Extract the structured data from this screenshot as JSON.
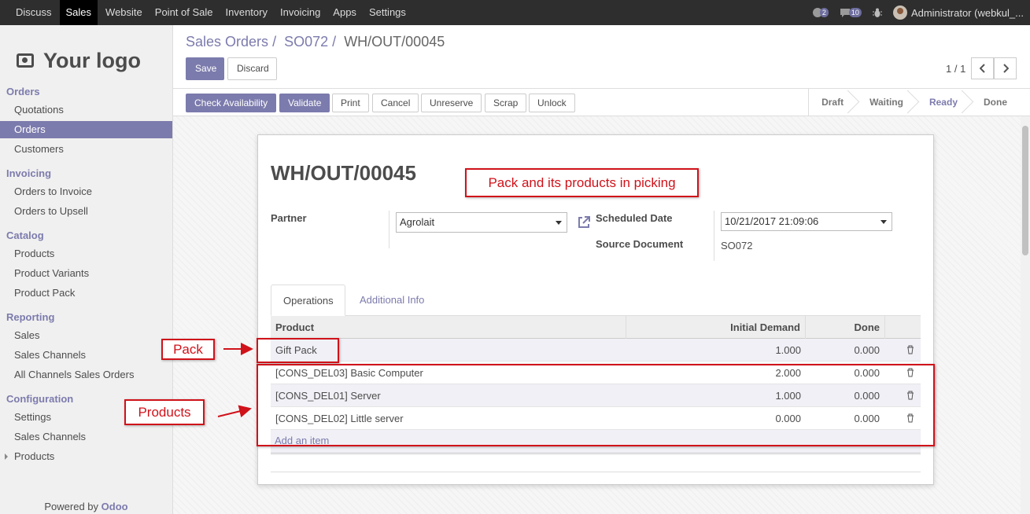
{
  "topbar": {
    "menu": [
      "Discuss",
      "Sales",
      "Website",
      "Point of Sale",
      "Inventory",
      "Invoicing",
      "Apps",
      "Settings"
    ],
    "active_menu": "Sales",
    "chat_count": "2",
    "message_count": "10",
    "user": "Administrator (webkul_..."
  },
  "sidebar": {
    "logo_text": "Your logo",
    "sections": [
      {
        "title": "Orders",
        "items": [
          "Quotations",
          "Orders",
          "Customers"
        ]
      },
      {
        "title": "Invoicing",
        "items": [
          "Orders to Invoice",
          "Orders to Upsell"
        ]
      },
      {
        "title": "Catalog",
        "items": [
          "Products",
          "Product Variants",
          "Product Pack"
        ]
      },
      {
        "title": "Reporting",
        "items": [
          "Sales",
          "Sales Channels",
          "All Channels Sales Orders"
        ]
      },
      {
        "title": "Configuration",
        "items": [
          "Settings",
          "Sales Channels",
          "Products"
        ]
      }
    ],
    "active_item": "Orders",
    "powered_by": "Powered by",
    "powered_brand": "Odoo"
  },
  "breadcrumb": {
    "items": [
      "Sales Orders",
      "SO072"
    ],
    "current": "WH/OUT/00045",
    "sep": "/"
  },
  "control": {
    "save": "Save",
    "discard": "Discard",
    "pager": "1 / 1"
  },
  "actions": [
    "Check Availability",
    "Validate",
    "Print",
    "Cancel",
    "Unreserve",
    "Scrap",
    "Unlock"
  ],
  "stages": [
    "Draft",
    "Waiting",
    "Ready",
    "Done"
  ],
  "current_stage": "Ready",
  "record": {
    "name": "WH/OUT/00045",
    "partner_label": "Partner",
    "partner_value": "Agrolait",
    "scheduled_label": "Scheduled Date",
    "scheduled_value": "10/21/2017 21:09:06",
    "source_label": "Source Document",
    "source_value": "SO072"
  },
  "tabs": [
    "Operations",
    "Additional Info"
  ],
  "table": {
    "headers": [
      "Product",
      "Initial Demand",
      "Done"
    ],
    "rows": [
      {
        "product": "Gift Pack",
        "demand": "1.000",
        "done": "0.000"
      },
      {
        "product": "[CONS_DEL03] Basic Computer",
        "demand": "2.000",
        "done": "0.000"
      },
      {
        "product": "[CONS_DEL01] Server",
        "demand": "1.000",
        "done": "0.000"
      },
      {
        "product": "[CONS_DEL02] Little server",
        "demand": "0.000",
        "done": "0.000"
      }
    ],
    "add_item": "Add an item"
  },
  "annotations": {
    "title_note": "Pack and its products in picking",
    "pack_note": "Pack",
    "products_note": "Products"
  },
  "colors": {
    "brand": "#7c7bad",
    "annotation": "#d0121a",
    "topbar": "#2e2e2e"
  }
}
